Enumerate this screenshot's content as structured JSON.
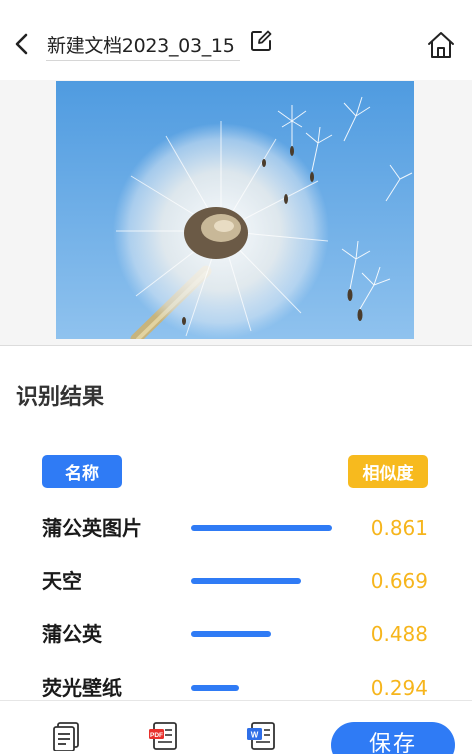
{
  "header": {
    "document_title": "新建文档2023_03_15",
    "icons": {
      "back": "chevron-left-icon",
      "edit": "edit-icon",
      "home": "home-icon"
    }
  },
  "image": {
    "subject": "dandelion-photo",
    "colors": {
      "sky": "#4f9be0",
      "seed_head": "#f4f1ea"
    }
  },
  "results": {
    "title": "识别结果",
    "name_header": "名称",
    "similarity_header": "相似度",
    "items": [
      {
        "name": "蒲公英图片",
        "score": "0.861",
        "similarity": 0.861
      },
      {
        "name": "天空",
        "score": "0.669",
        "similarity": 0.669
      },
      {
        "name": "蒲公英",
        "score": "0.488",
        "similarity": 0.488
      },
      {
        "name": "荧光壁纸",
        "score": "0.294",
        "similarity": 0.294
      }
    ]
  },
  "toolbar": {
    "icons": [
      "text-document-icon",
      "pdf-document-icon",
      "word-document-icon"
    ],
    "pdf_badge": "PDF",
    "word_badge": "W",
    "save_label": "保存"
  },
  "colors": {
    "accent_blue": "#2f7bf5",
    "accent_yellow": "#f7ba1e"
  }
}
